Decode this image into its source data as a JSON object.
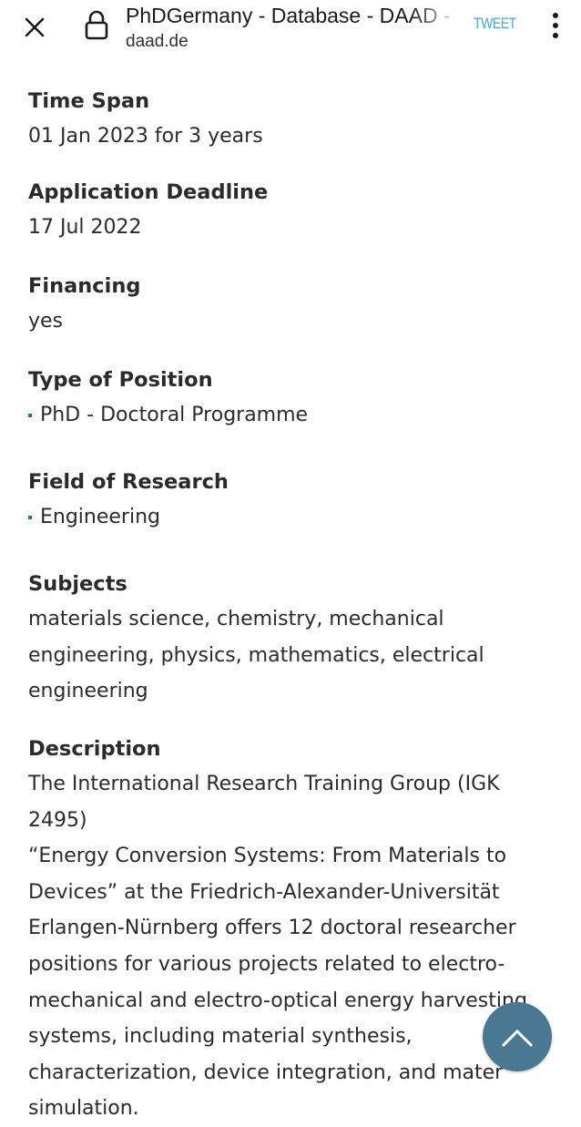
{
  "browser": {
    "title": "PhDGermany - Database - DAAD -",
    "url": "daad.de",
    "tweet_label": "TWEET",
    "icons": {
      "close": "close-icon",
      "lock": "lock-icon",
      "menu": "more-vert-icon"
    }
  },
  "details": {
    "time_span": {
      "label": "Time Span",
      "value": "01 Jan 2023 for 3 years"
    },
    "deadline": {
      "label": "Application Deadline",
      "value": "17 Jul 2022"
    },
    "financing": {
      "label": "Financing",
      "value": "yes"
    },
    "position_type": {
      "label": "Type of Position",
      "items": [
        "PhD - Doctoral Programme"
      ]
    },
    "field": {
      "label": "Field of Research",
      "items": [
        "Engineering"
      ]
    },
    "subjects": {
      "label": "Subjects",
      "lines": [
        "materials science, chemistry, mechanical",
        "engineering, physics, mathematics, electrical",
        "engineering"
      ]
    },
    "description": {
      "label": "Description",
      "lines": [
        "The International Research Training Group (IGK 2495)",
        "“Energy Conversion Systems: From Materials to",
        "Devices” at the Friedrich-Alexander-Universität",
        "Erlangen-Nürnberg offers 12 doctoral researcher",
        "positions for various projects related to electro-",
        "mechanical and electro-optical energy harvesting",
        "systems, including material synthesis,",
        "characterization, device integration, and mater",
        "simulation."
      ]
    }
  },
  "scroll_top": {
    "icon": "chevron-up-icon",
    "color": "#4a7893"
  },
  "colors": {
    "accent": "#1e6fb8",
    "tweet": "#4aa6d6"
  }
}
